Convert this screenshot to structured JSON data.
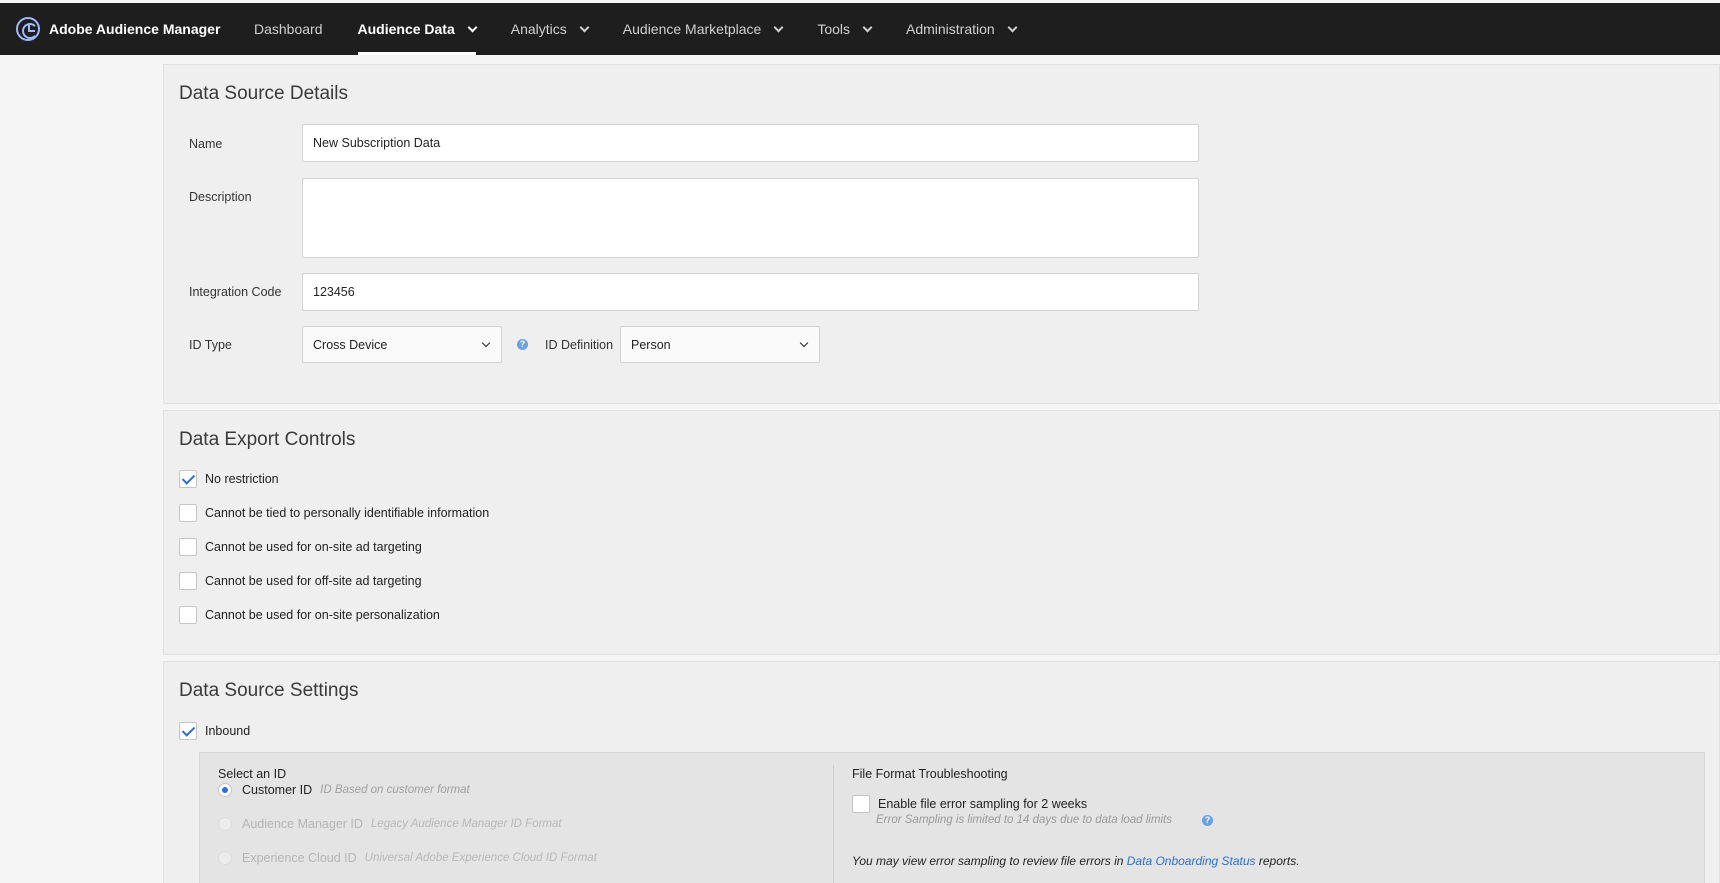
{
  "header": {
    "brand": "Adobe Audience Manager",
    "nav": [
      {
        "label": "Dashboard",
        "dropdown": false,
        "active": false
      },
      {
        "label": "Audience Data",
        "dropdown": true,
        "active": true
      },
      {
        "label": "Analytics",
        "dropdown": true,
        "active": false
      },
      {
        "label": "Audience Marketplace",
        "dropdown": true,
        "active": false
      },
      {
        "label": "Tools",
        "dropdown": true,
        "active": false
      },
      {
        "label": "Administration",
        "dropdown": true,
        "active": false
      }
    ]
  },
  "details": {
    "title": "Data Source Details",
    "name_label": "Name",
    "name_value": "New Subscription Data",
    "description_label": "Description",
    "description_value": "",
    "integration_code_label": "Integration Code",
    "integration_code_value": "123456",
    "id_type_label": "ID Type",
    "id_type_value": "Cross Device",
    "id_definition_label": "ID Definition",
    "id_definition_value": "Person",
    "info_glyph": "?"
  },
  "export_controls": {
    "title": "Data Export Controls",
    "options": [
      {
        "label": "No restriction",
        "checked": true
      },
      {
        "label": "Cannot be tied to personally identifiable information",
        "checked": false
      },
      {
        "label": "Cannot be used for on-site ad targeting",
        "checked": false
      },
      {
        "label": "Cannot be used for off-site ad targeting",
        "checked": false
      },
      {
        "label": "Cannot be used for on-site personalization",
        "checked": false
      }
    ]
  },
  "settings": {
    "title": "Data Source Settings",
    "inbound_label": "Inbound",
    "inbound_checked": true,
    "select_id_title": "Select an ID",
    "id_options": [
      {
        "label": "Customer ID",
        "hint": "ID Based on customer format",
        "selected": true,
        "disabled": false
      },
      {
        "label": "Audience Manager ID",
        "hint": "Legacy Audience Manager ID Format",
        "selected": false,
        "disabled": true
      },
      {
        "label": "Experience Cloud ID",
        "hint": "Universal Adobe Experience Cloud ID Format",
        "selected": false,
        "disabled": true
      }
    ],
    "troubleshooting_title": "File Format Troubleshooting",
    "sampling_label": "Enable file error sampling for 2 weeks",
    "sampling_checked": false,
    "sampling_hint": "Error Sampling is limited to 14 days due to data load limits",
    "note_prefix": "You may view error sampling to review file errors in ",
    "note_link": "Data Onboarding Status",
    "note_suffix": " reports."
  },
  "colors": {
    "topbar": "#1e1e1e",
    "accent": "#2d6fd8",
    "panel": "#efefef",
    "page": "#f5f5f5"
  }
}
